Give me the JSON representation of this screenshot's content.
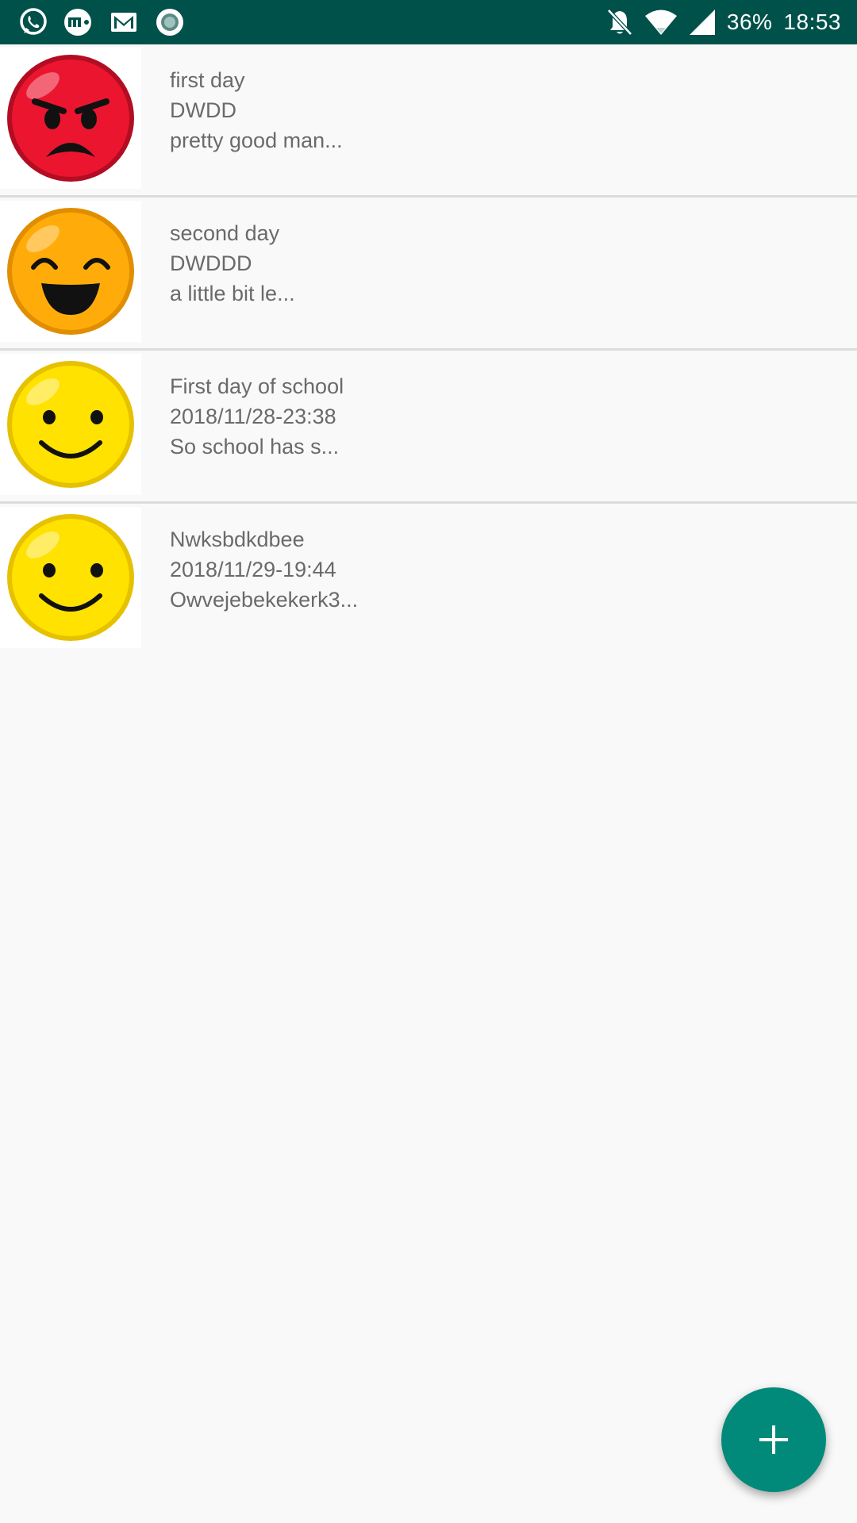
{
  "status_bar": {
    "battery": "36%",
    "time": "18:53",
    "background_color": "#01514b",
    "icons_left": [
      "whatsapp-icon",
      "mi-fit-icon",
      "gmail-icon",
      "record-icon"
    ],
    "icons_right": [
      "notifications-off-icon",
      "wifi-icon",
      "signal-icon"
    ]
  },
  "entries": [
    {
      "title": "first day",
      "date": "DWDD",
      "preview": "pretty good man...",
      "mood_icon": "angry-face-icon"
    },
    {
      "title": "second day",
      "date": "DWDDD",
      "preview": "a little bit le...",
      "mood_icon": "grinning-face-icon"
    },
    {
      "title": "First day of school",
      "date": "2018/11/28-23:38",
      "preview": "So school has s...",
      "mood_icon": "smiling-face-icon"
    },
    {
      "title": "Nwksbdkdbee",
      "date": "2018/11/29-19:44",
      "preview": "Owvejebekekerk3...",
      "mood_icon": "smiling-face-icon"
    }
  ],
  "fab": {
    "icon": "plus-icon",
    "color": "#018a7a"
  }
}
